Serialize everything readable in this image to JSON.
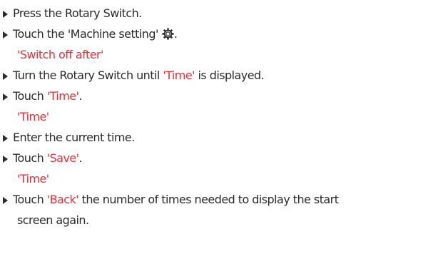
{
  "steps": [
    {
      "prefix": "Press the Rotary Switch."
    },
    {
      "prefix": "Touch the ",
      "quoted": "'Machine setting'",
      "icon": "gear-icon",
      "suffix": "."
    },
    {
      "result": "'Switch off after'"
    },
    {
      "prefix": "Turn the Rotary Switch until ",
      "quoted": "'Time'",
      "suffix": " is displayed."
    },
    {
      "prefix": "Touch ",
      "quoted": "'Time'",
      "suffix": "."
    },
    {
      "result": "'Time'"
    },
    {
      "prefix": "Enter the current time."
    },
    {
      "prefix": "Touch ",
      "quoted": "'Save'",
      "suffix": "."
    },
    {
      "result": "'Time'"
    },
    {
      "prefix": "Touch ",
      "quoted": "'Back'",
      "suffix": " the number of times needed to display the start"
    },
    {
      "continuation": "screen again."
    }
  ],
  "colors": {
    "text": "#2b2b2b",
    "highlight": "#e4313b"
  }
}
